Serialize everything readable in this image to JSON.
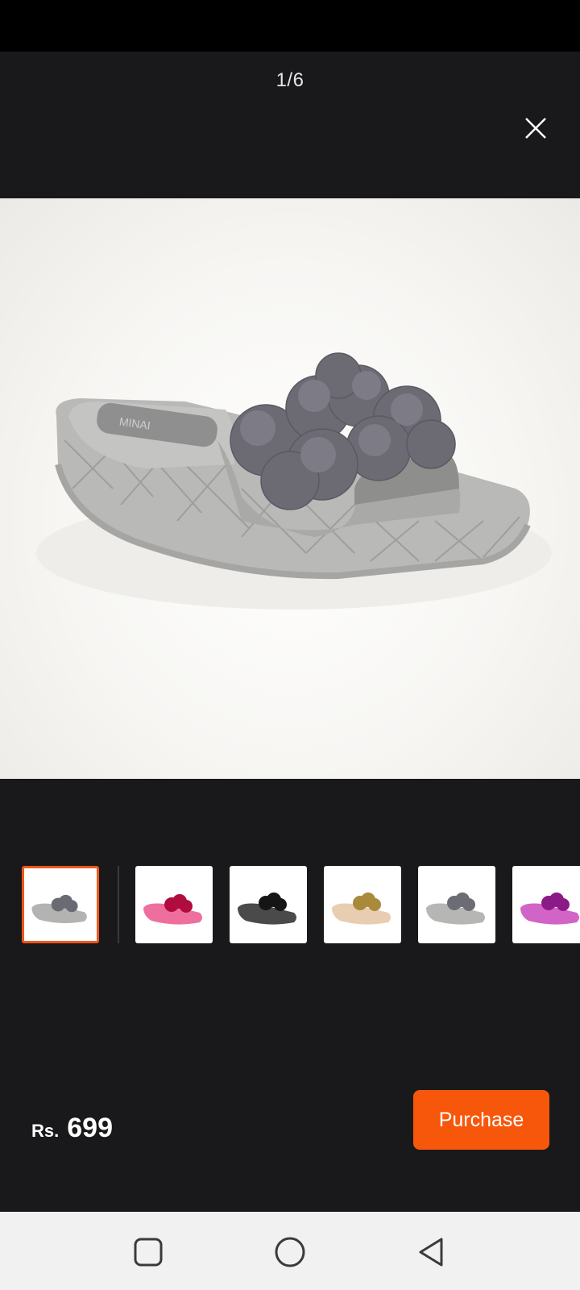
{
  "viewer": {
    "counter": "1/6",
    "close_icon": "close-icon"
  },
  "colors": {
    "accent": "#f7570b",
    "selected_border": "#f0561a",
    "background": "#19191b"
  },
  "thumbnails": [
    {
      "color": "grey",
      "selected": true
    },
    {
      "color": "pink",
      "selected": false
    },
    {
      "color": "black",
      "selected": false
    },
    {
      "color": "gold",
      "selected": false
    },
    {
      "color": "grey",
      "selected": false
    },
    {
      "color": "purple",
      "selected": false
    }
  ],
  "product": {
    "currency": "Rs.",
    "price": "699"
  },
  "actions": {
    "purchase_label": "Purchase"
  },
  "system_nav": {
    "recents_icon": "square-icon",
    "home_icon": "circle-icon",
    "back_icon": "triangle-back-icon"
  }
}
